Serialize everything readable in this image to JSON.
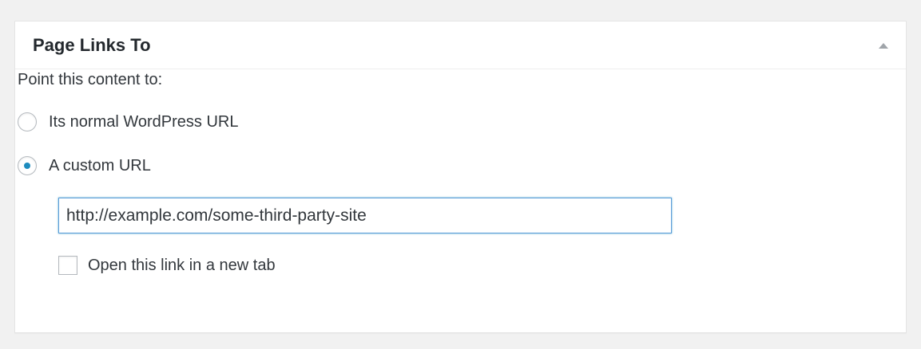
{
  "metabox": {
    "title": "Page Links To",
    "toggle_icon": "triangle-up-icon"
  },
  "form": {
    "intro": "Point this content to:",
    "options": [
      {
        "label": "Its normal WordPress URL",
        "checked": false
      },
      {
        "label": "A custom URL",
        "checked": true
      }
    ],
    "url_value": "http://example.com/some-third-party-site",
    "new_tab_label": "Open this link in a new tab",
    "new_tab_checked": false
  },
  "colors": {
    "accent": "#1e8cbe",
    "focus_border": "#5b9dd9",
    "background": "#f1f1f1",
    "panel": "#ffffff"
  }
}
